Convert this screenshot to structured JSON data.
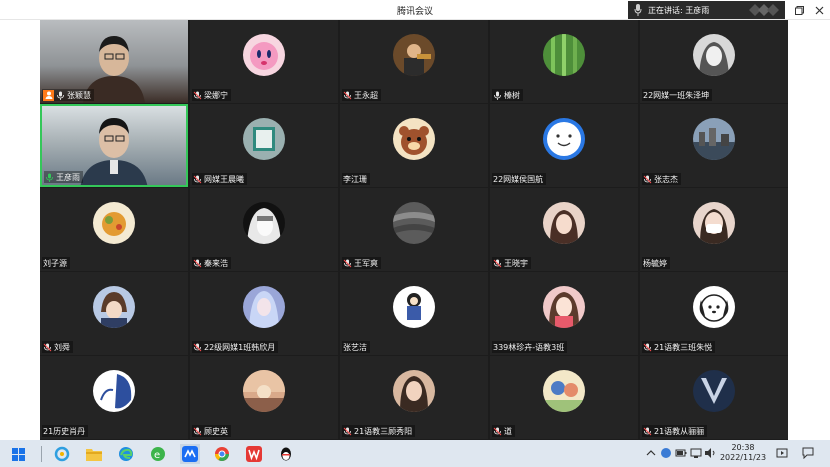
{
  "window": {
    "title": "腾讯会议",
    "speaking_label": "正在讲话: 王彦雨"
  },
  "participants": [
    {
      "name": "张颖慧",
      "kind": "video-a",
      "host": true,
      "mic": "on"
    },
    {
      "name": "梁娜宁",
      "kind": "avatar",
      "avatar": "kirby",
      "mic": "muted"
    },
    {
      "name": "王永超",
      "kind": "avatar",
      "avatar": "guitar",
      "mic": "muted"
    },
    {
      "name": "榛树",
      "kind": "avatar",
      "avatar": "bamboo",
      "mic": "on"
    },
    {
      "name": "22网媒一班朱泽坤",
      "kind": "avatar",
      "avatar": "anime-bw",
      "mic": "none"
    },
    {
      "name": "王彦雨",
      "kind": "video-b",
      "host": false,
      "mic": "speaking"
    },
    {
      "name": "网媒王晨曦",
      "kind": "avatar",
      "avatar": "book",
      "mic": "muted"
    },
    {
      "name": "李江珊",
      "kind": "avatar",
      "avatar": "bear",
      "mic": "none"
    },
    {
      "name": "22网媒侯国航",
      "kind": "avatar",
      "avatar": "smile",
      "mic": "none"
    },
    {
      "name": "张志杰",
      "kind": "avatar",
      "avatar": "city",
      "mic": "muted"
    },
    {
      "name": "刘子源",
      "kind": "avatar",
      "avatar": "food",
      "mic": "none"
    },
    {
      "name": "秦来浩",
      "kind": "avatar",
      "avatar": "anime-dark",
      "mic": "muted"
    },
    {
      "name": "王军爽",
      "kind": "avatar",
      "avatar": "stone",
      "mic": "muted"
    },
    {
      "name": "王晓宇",
      "kind": "avatar",
      "avatar": "girl",
      "mic": "muted"
    },
    {
      "name": "杨毓婷",
      "kind": "avatar",
      "avatar": "mask",
      "mic": "none"
    },
    {
      "name": "刘舜",
      "kind": "avatar",
      "avatar": "anime-boy",
      "mic": "muted"
    },
    {
      "name": "22级网媒1班韩欣月",
      "kind": "avatar",
      "avatar": "anime-blue",
      "mic": "muted"
    },
    {
      "name": "张艺洁",
      "kind": "avatar",
      "avatar": "cartoon",
      "mic": "none"
    },
    {
      "name": "339林珍卉-语教3班",
      "kind": "avatar",
      "avatar": "girl2",
      "mic": "none"
    },
    {
      "name": "21语教三班朱悦",
      "kind": "avatar",
      "avatar": "pochacco",
      "mic": "muted"
    },
    {
      "name": "21历史肖丹",
      "kind": "avatar",
      "avatar": "blue-white",
      "mic": "none"
    },
    {
      "name": "顾史英",
      "kind": "avatar",
      "avatar": "sunset",
      "mic": "muted"
    },
    {
      "name": "21语教三顾秀阳",
      "kind": "avatar",
      "avatar": "portrait",
      "mic": "muted"
    },
    {
      "name": "道",
      "kind": "avatar",
      "avatar": "illustration",
      "mic": "muted"
    },
    {
      "name": "21语教从骊骊",
      "kind": "avatar",
      "avatar": "v-logo",
      "mic": "muted"
    }
  ],
  "taskbar": {
    "time": "20:38",
    "date": "2022/11/23",
    "apps": [
      "windows-start",
      "search",
      "file-explorer",
      "edge",
      "green-browser",
      "tencent-meeting",
      "colorful-app",
      "wps",
      "qq"
    ]
  },
  "colors": {
    "gallery_bg": "#1c1c1c",
    "tile_bg": "#242424",
    "speaking_border": "#34c759",
    "host_badge": "#ff7a1a",
    "taskbar": "#dfe7f0"
  }
}
